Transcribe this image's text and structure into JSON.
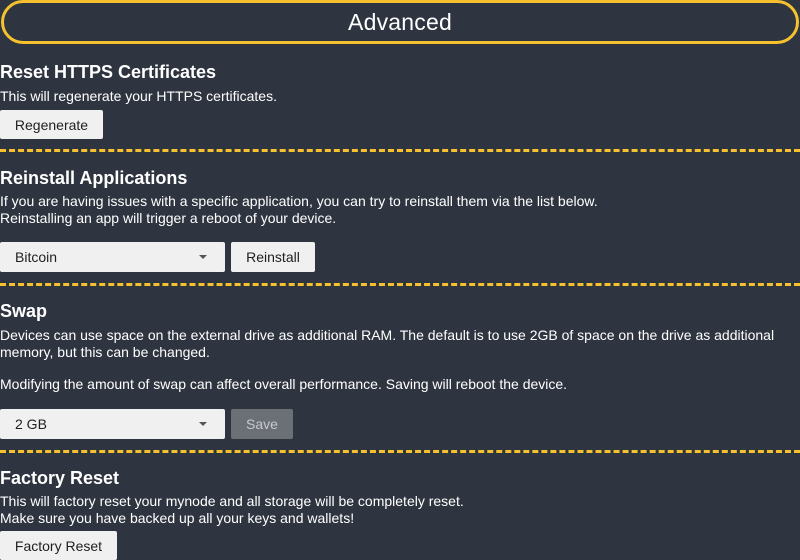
{
  "header": {
    "title": "Advanced"
  },
  "sections": {
    "reset_https": {
      "title": "Reset HTTPS Certificates",
      "text": "This will regenerate your HTTPS certificates.",
      "button": "Regenerate"
    },
    "reinstall": {
      "title": "Reinstall Applications",
      "text_line1": "If you are having issues with a specific application, you can try to reinstall them via the list below.",
      "text_line2": "Reinstalling an app will trigger a reboot of your device.",
      "select_value": "Bitcoin",
      "button": "Reinstall"
    },
    "swap": {
      "title": "Swap",
      "text_line1": "Devices can use space on the external drive as additional RAM. The default is to use 2GB of space on the drive as additional",
      "text_line2": "memory, but this can be changed.",
      "text_line3": "Modifying the amount of swap can affect overall performance. Saving will reboot the device.",
      "select_value": "2 GB",
      "button": "Save"
    },
    "factory_reset": {
      "title": "Factory Reset",
      "text_line1": "This will factory reset your mynode and all storage will be completely reset.",
      "text_line2": "Make sure you have backed up all your keys and wallets!",
      "button": "Factory Reset"
    }
  },
  "colors": {
    "background": "#2f3540",
    "accent": "#f5c12e",
    "button": "#f0f0f0",
    "button_disabled": "#6b6f76"
  }
}
